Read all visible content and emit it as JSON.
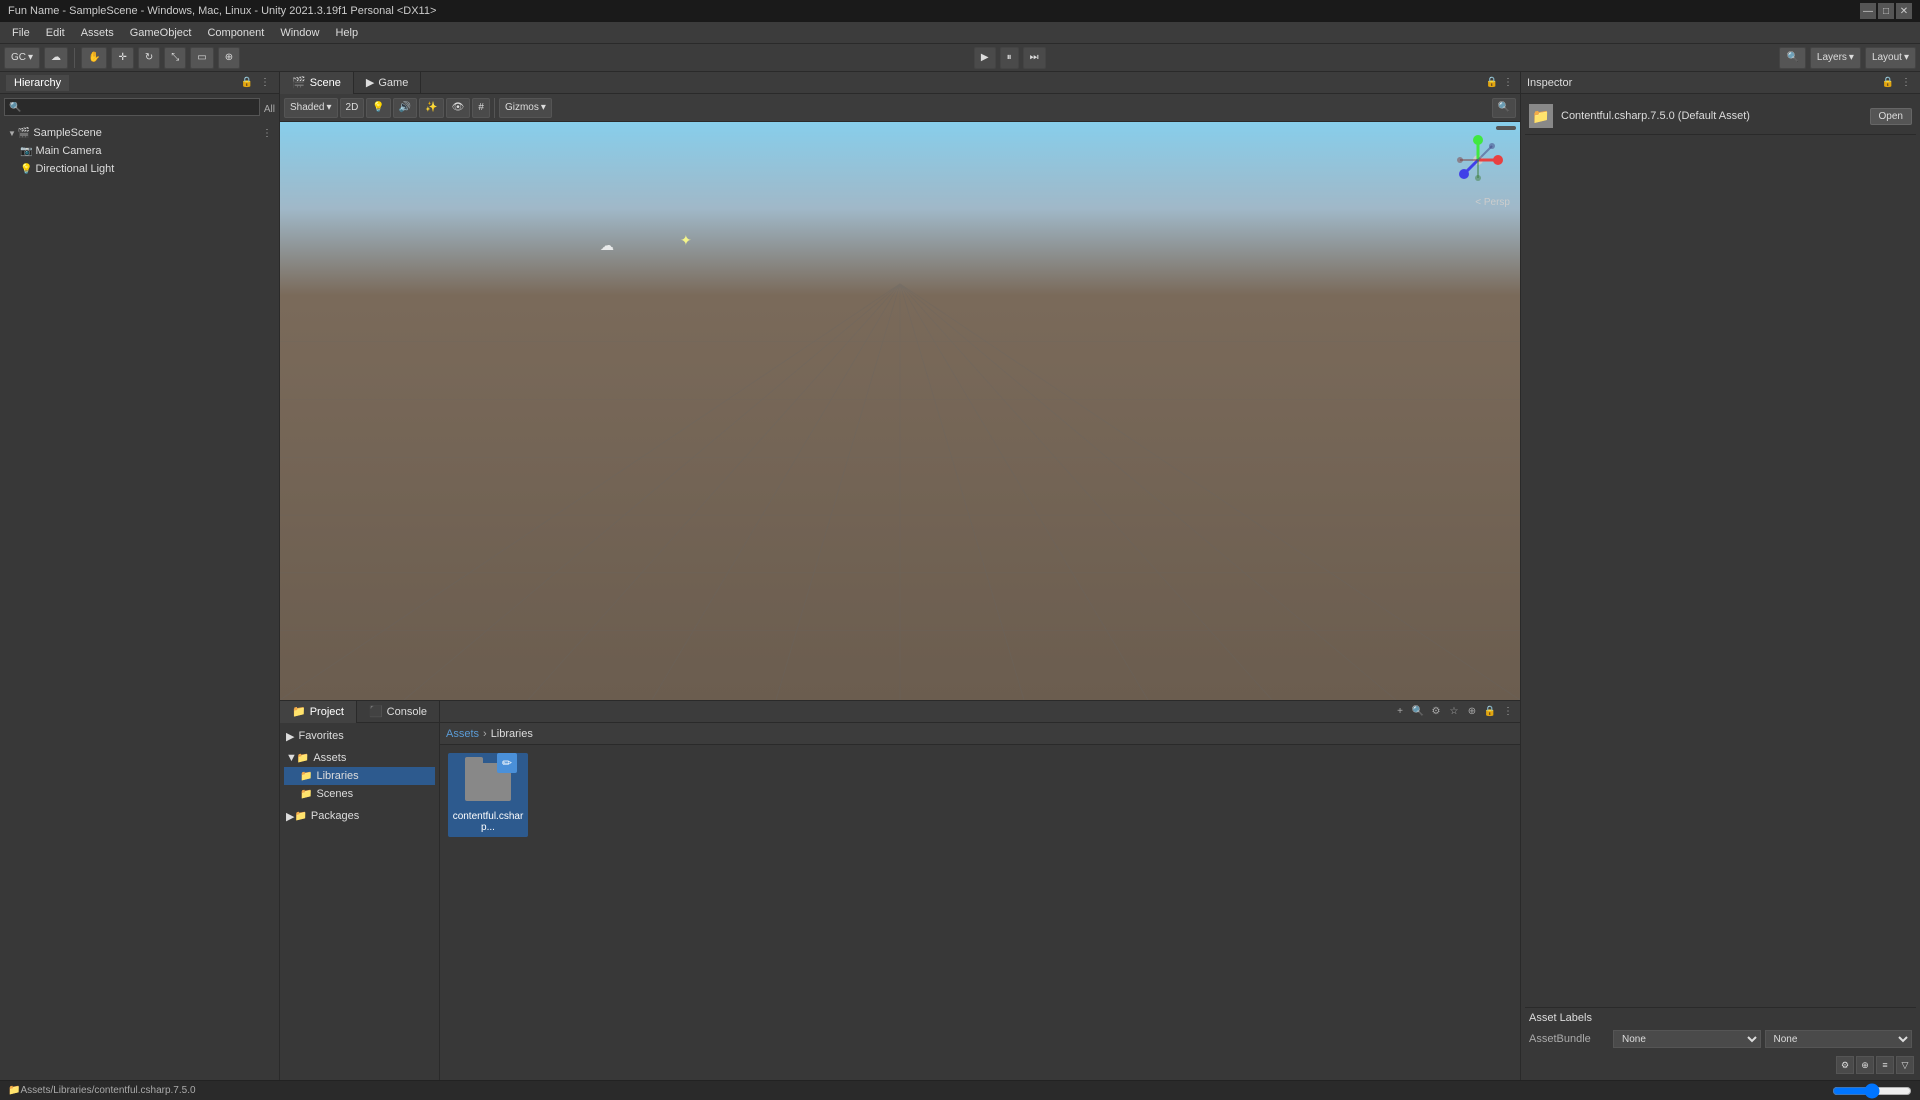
{
  "title_bar": {
    "title": "Fun Name - SampleScene - Windows, Mac, Linux - Unity 2021.3.19f1 Personal <DX11>",
    "min_btn": "—",
    "max_btn": "□",
    "close_btn": "✕"
  },
  "menu": {
    "items": [
      "File",
      "Edit",
      "Assets",
      "GameObject",
      "Component",
      "Window",
      "Help"
    ]
  },
  "toolbar": {
    "gc_label": "GC",
    "cloud_icon": "☁",
    "play_btn": "▶",
    "pause_btn": "⏸",
    "step_btn": "⏭",
    "layers_label": "Layers",
    "layout_label": "Layout"
  },
  "hierarchy": {
    "tab_label": "Hierarchy",
    "all_label": "All",
    "scene_name": "SampleScene",
    "items": [
      {
        "label": "Main Camera",
        "indent": 2
      },
      {
        "label": "Directional Light",
        "indent": 2
      }
    ]
  },
  "scene": {
    "tab_label": "Scene",
    "game_tab_label": "Game",
    "persp_label": "< Persp",
    "scene_2d_label": "2D",
    "toolbar_buttons": [
      "shading",
      "2D",
      "lighting",
      "audio",
      "fx",
      "scene_camera",
      "gizmos"
    ]
  },
  "inspector": {
    "tab_label": "Inspector",
    "asset_name": "Contentful.csharp.7.5.0 (Default Asset)",
    "open_btn_label": "Open",
    "asset_labels_title": "Asset Labels",
    "asset_bundle_label": "AssetBundle",
    "asset_bundle_value": "None",
    "asset_bundle_value2": "None"
  },
  "project": {
    "tab_label": "Project",
    "console_tab_label": "Console",
    "breadcrumb": {
      "root": "Assets",
      "current": "Libraries"
    },
    "left_panel": {
      "favorites_label": "Favorites",
      "assets_label": "Assets",
      "libraries_label": "Libraries",
      "scenes_label": "Scenes",
      "packages_label": "Packages"
    },
    "assets": [
      {
        "name": "contentful.csharp...",
        "type": "folder_with_badge",
        "badge_icon": "✏"
      }
    ]
  },
  "status_bar": {
    "path": "Assets/Libraries/contentful.csharp.7.5.0",
    "slider_value": "—"
  }
}
